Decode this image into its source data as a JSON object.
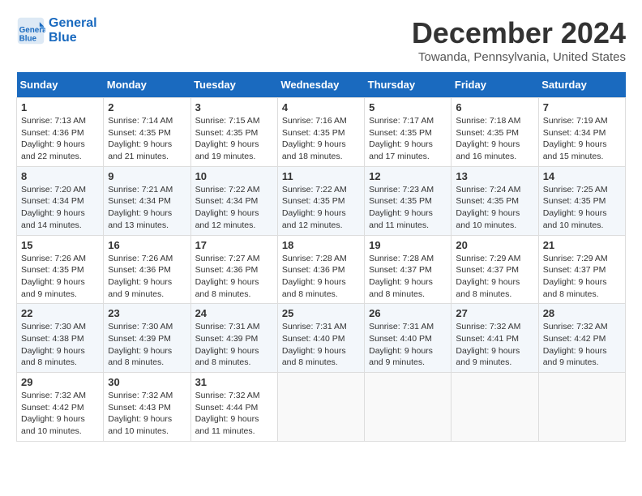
{
  "header": {
    "logo_line1": "General",
    "logo_line2": "Blue",
    "month": "December 2024",
    "location": "Towanda, Pennsylvania, United States"
  },
  "weekdays": [
    "Sunday",
    "Monday",
    "Tuesday",
    "Wednesday",
    "Thursday",
    "Friday",
    "Saturday"
  ],
  "weeks": [
    [
      {
        "day": "1",
        "sunrise": "7:13 AM",
        "sunset": "4:36 PM",
        "daylight": "9 hours and 22 minutes."
      },
      {
        "day": "2",
        "sunrise": "7:14 AM",
        "sunset": "4:35 PM",
        "daylight": "9 hours and 21 minutes."
      },
      {
        "day": "3",
        "sunrise": "7:15 AM",
        "sunset": "4:35 PM",
        "daylight": "9 hours and 19 minutes."
      },
      {
        "day": "4",
        "sunrise": "7:16 AM",
        "sunset": "4:35 PM",
        "daylight": "9 hours and 18 minutes."
      },
      {
        "day": "5",
        "sunrise": "7:17 AM",
        "sunset": "4:35 PM",
        "daylight": "9 hours and 17 minutes."
      },
      {
        "day": "6",
        "sunrise": "7:18 AM",
        "sunset": "4:35 PM",
        "daylight": "9 hours and 16 minutes."
      },
      {
        "day": "7",
        "sunrise": "7:19 AM",
        "sunset": "4:34 PM",
        "daylight": "9 hours and 15 minutes."
      }
    ],
    [
      {
        "day": "8",
        "sunrise": "7:20 AM",
        "sunset": "4:34 PM",
        "daylight": "9 hours and 14 minutes."
      },
      {
        "day": "9",
        "sunrise": "7:21 AM",
        "sunset": "4:34 PM",
        "daylight": "9 hours and 13 minutes."
      },
      {
        "day": "10",
        "sunrise": "7:22 AM",
        "sunset": "4:34 PM",
        "daylight": "9 hours and 12 minutes."
      },
      {
        "day": "11",
        "sunrise": "7:22 AM",
        "sunset": "4:35 PM",
        "daylight": "9 hours and 12 minutes."
      },
      {
        "day": "12",
        "sunrise": "7:23 AM",
        "sunset": "4:35 PM",
        "daylight": "9 hours and 11 minutes."
      },
      {
        "day": "13",
        "sunrise": "7:24 AM",
        "sunset": "4:35 PM",
        "daylight": "9 hours and 10 minutes."
      },
      {
        "day": "14",
        "sunrise": "7:25 AM",
        "sunset": "4:35 PM",
        "daylight": "9 hours and 10 minutes."
      }
    ],
    [
      {
        "day": "15",
        "sunrise": "7:26 AM",
        "sunset": "4:35 PM",
        "daylight": "9 hours and 9 minutes."
      },
      {
        "day": "16",
        "sunrise": "7:26 AM",
        "sunset": "4:36 PM",
        "daylight": "9 hours and 9 minutes."
      },
      {
        "day": "17",
        "sunrise": "7:27 AM",
        "sunset": "4:36 PM",
        "daylight": "9 hours and 8 minutes."
      },
      {
        "day": "18",
        "sunrise": "7:28 AM",
        "sunset": "4:36 PM",
        "daylight": "9 hours and 8 minutes."
      },
      {
        "day": "19",
        "sunrise": "7:28 AM",
        "sunset": "4:37 PM",
        "daylight": "9 hours and 8 minutes."
      },
      {
        "day": "20",
        "sunrise": "7:29 AM",
        "sunset": "4:37 PM",
        "daylight": "9 hours and 8 minutes."
      },
      {
        "day": "21",
        "sunrise": "7:29 AM",
        "sunset": "4:37 PM",
        "daylight": "9 hours and 8 minutes."
      }
    ],
    [
      {
        "day": "22",
        "sunrise": "7:30 AM",
        "sunset": "4:38 PM",
        "daylight": "9 hours and 8 minutes."
      },
      {
        "day": "23",
        "sunrise": "7:30 AM",
        "sunset": "4:39 PM",
        "daylight": "9 hours and 8 minutes."
      },
      {
        "day": "24",
        "sunrise": "7:31 AM",
        "sunset": "4:39 PM",
        "daylight": "9 hours and 8 minutes."
      },
      {
        "day": "25",
        "sunrise": "7:31 AM",
        "sunset": "4:40 PM",
        "daylight": "9 hours and 8 minutes."
      },
      {
        "day": "26",
        "sunrise": "7:31 AM",
        "sunset": "4:40 PM",
        "daylight": "9 hours and 9 minutes."
      },
      {
        "day": "27",
        "sunrise": "7:32 AM",
        "sunset": "4:41 PM",
        "daylight": "9 hours and 9 minutes."
      },
      {
        "day": "28",
        "sunrise": "7:32 AM",
        "sunset": "4:42 PM",
        "daylight": "9 hours and 9 minutes."
      }
    ],
    [
      {
        "day": "29",
        "sunrise": "7:32 AM",
        "sunset": "4:42 PM",
        "daylight": "9 hours and 10 minutes."
      },
      {
        "day": "30",
        "sunrise": "7:32 AM",
        "sunset": "4:43 PM",
        "daylight": "9 hours and 10 minutes."
      },
      {
        "day": "31",
        "sunrise": "7:32 AM",
        "sunset": "4:44 PM",
        "daylight": "9 hours and 11 minutes."
      },
      null,
      null,
      null,
      null
    ]
  ],
  "labels": {
    "sunrise": "Sunrise:",
    "sunset": "Sunset:",
    "daylight": "Daylight:"
  }
}
